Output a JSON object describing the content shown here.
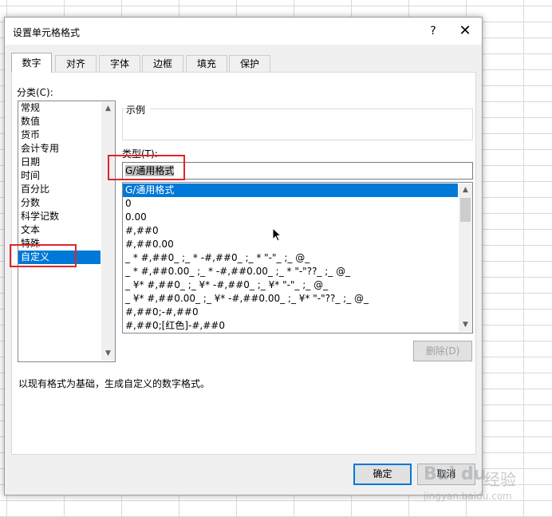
{
  "dialog": {
    "title": "设置单元格格式",
    "help_label": "?",
    "close_label": "✕"
  },
  "tabs": [
    {
      "label": "数字",
      "active": true
    },
    {
      "label": "对齐",
      "active": false
    },
    {
      "label": "字体",
      "active": false
    },
    {
      "label": "边框",
      "active": false
    },
    {
      "label": "填充",
      "active": false
    },
    {
      "label": "保护",
      "active": false
    }
  ],
  "category": {
    "label": "分类(C):",
    "items": [
      "常规",
      "数值",
      "货币",
      "会计专用",
      "日期",
      "时间",
      "百分比",
      "分数",
      "科学记数",
      "文本",
      "特殊",
      "自定义"
    ],
    "selected": "自定义"
  },
  "sample": {
    "label": "示例"
  },
  "type": {
    "label": "类型(T):",
    "value": "G/通用格式",
    "formats": [
      "G/通用格式",
      "0",
      "0.00",
      "#,##0",
      "#,##0.00",
      "_ * #,##0_ ;_ * -#,##0_ ;_ * \"-\"_ ;_ @_",
      "_ * #,##0.00_ ;_ * -#,##0.00_ ;_ * \"-\"??_ ;_ @_",
      "_ ¥* #,##0_ ;_ ¥* -#,##0_ ;_ ¥* \"-\"_ ;_ @_",
      "_ ¥* #,##0.00_ ;_ ¥* -#,##0.00_ ;_ ¥* \"-\"??_ ;_ @_",
      "#,##0;-#,##0",
      "#,##0;[红色]-#,##0"
    ],
    "selected_index": 0
  },
  "delete_label": "删除(D)",
  "description": "以现有格式为基础，生成自定义的数字格式。",
  "buttons": {
    "ok": "确定",
    "cancel": "取消"
  },
  "watermark": {
    "logo": "Bai du",
    "cn": "经验",
    "url": "jingyan.baidu.com"
  },
  "colors": {
    "selection": "#0078d7",
    "highlight_box": "#e0242a"
  }
}
